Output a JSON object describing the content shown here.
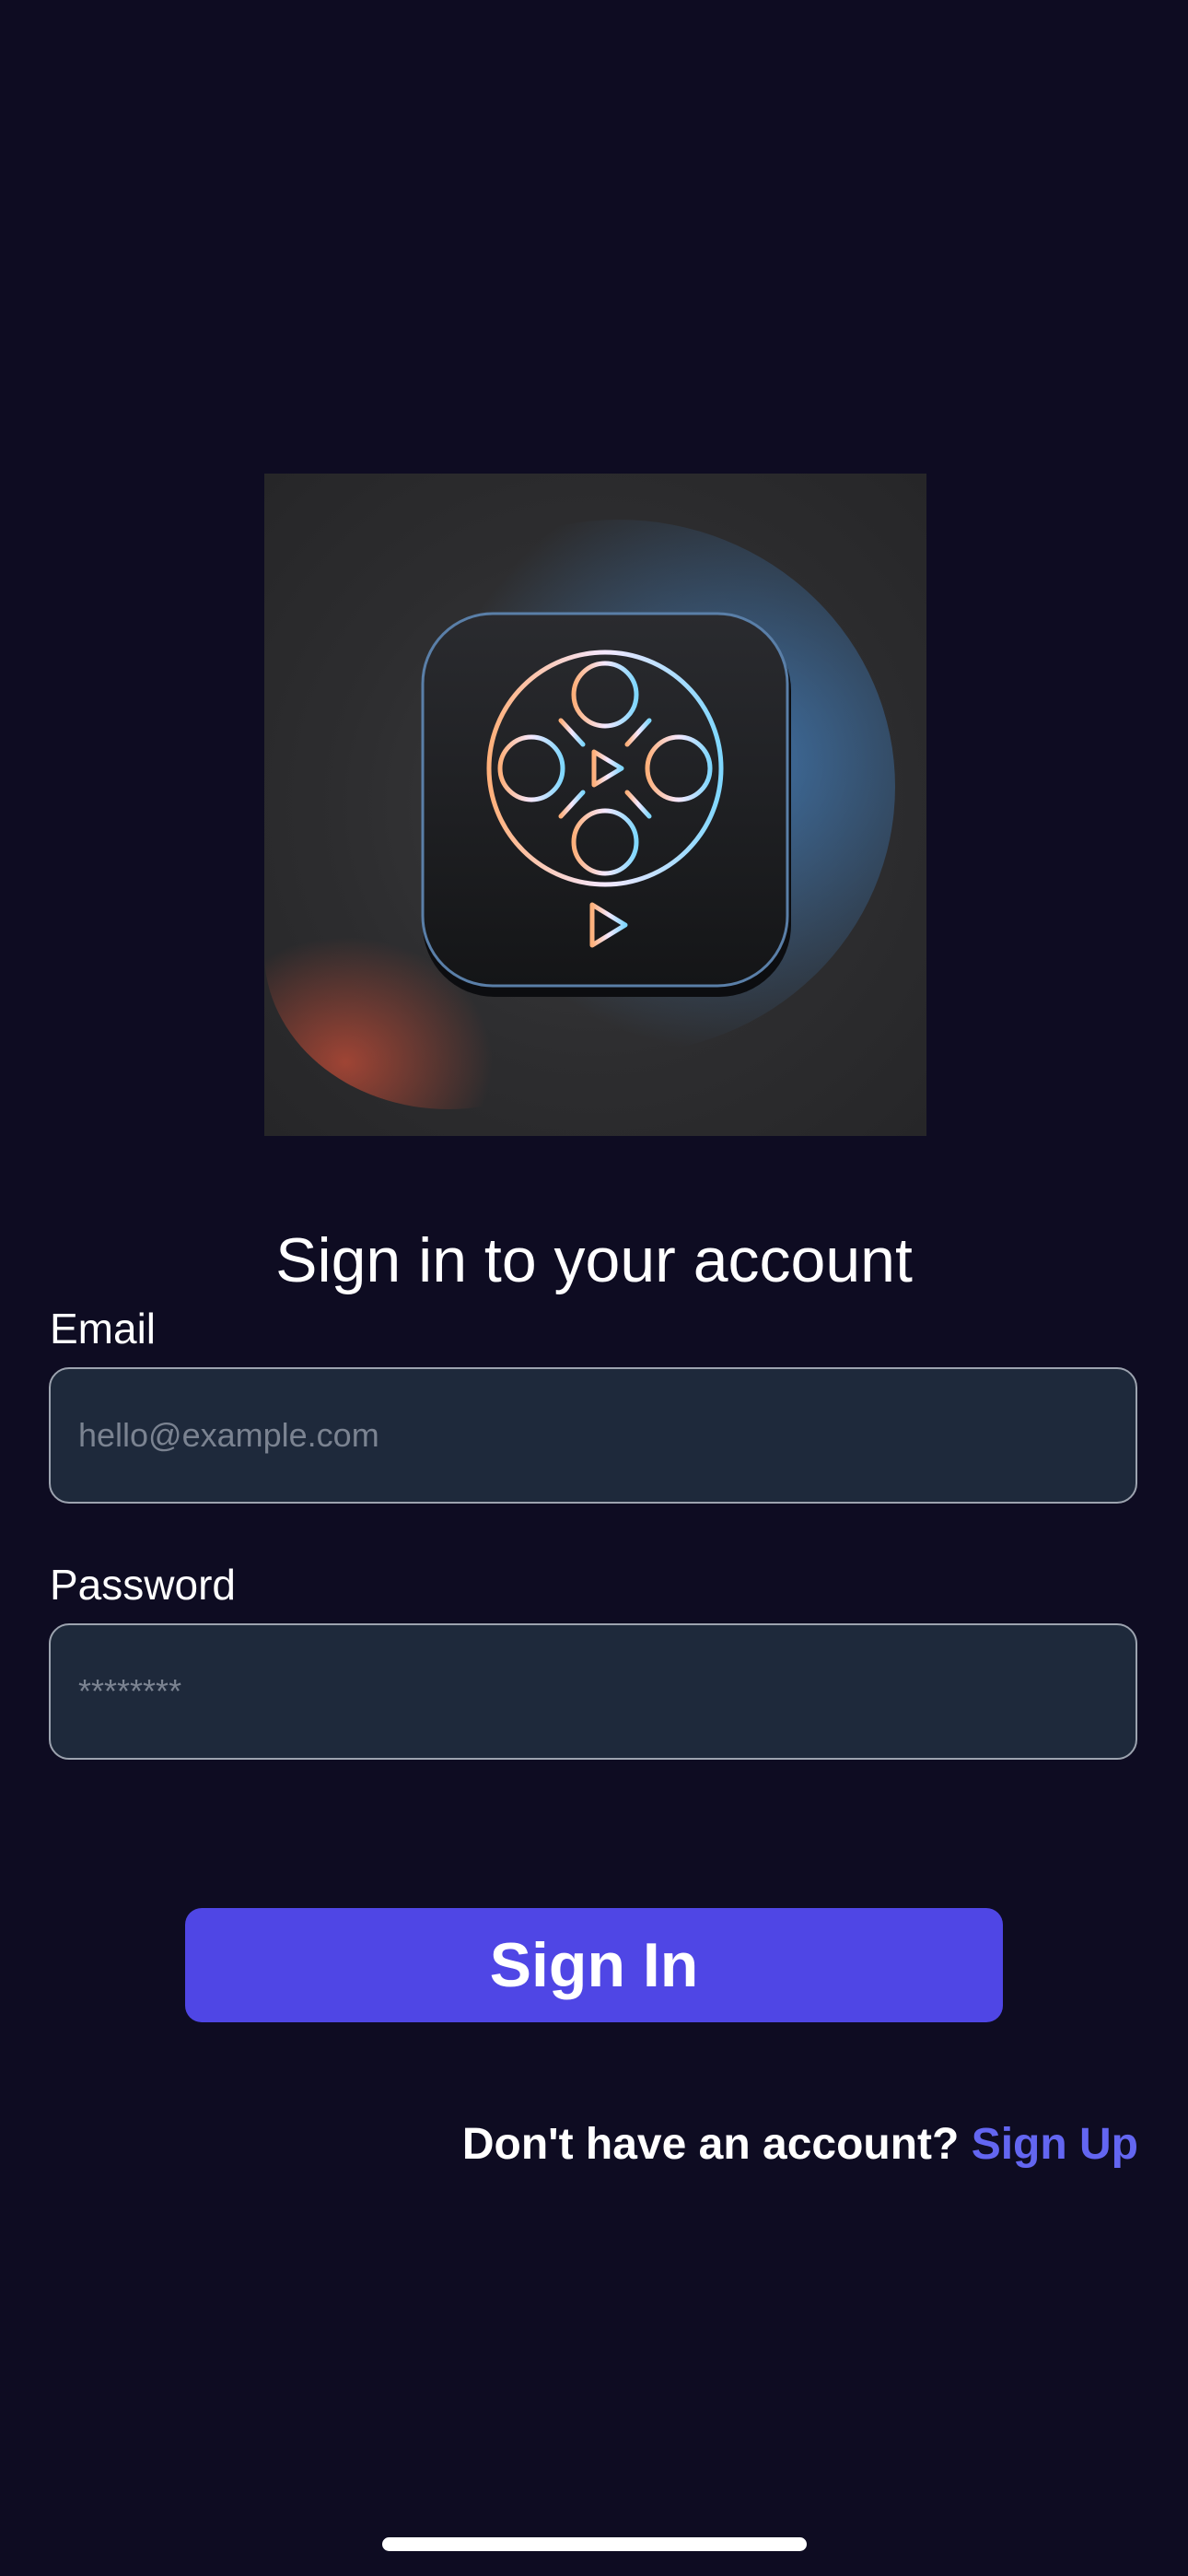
{
  "auth": {
    "title": "Sign in to your account",
    "email_label": "Email",
    "email_placeholder": "hello@example.com",
    "password_label": "Password",
    "password_placeholder": "********",
    "submit_label": "Sign In",
    "signup_prompt": "Don't have an account?",
    "signup_link": "Sign Up"
  },
  "colors": {
    "background": "#0e0c22",
    "accent": "#4f46e5",
    "link": "#6366f1",
    "input_background": "#1e293b"
  },
  "icons": {
    "logo": "film-reel-play-icon"
  }
}
